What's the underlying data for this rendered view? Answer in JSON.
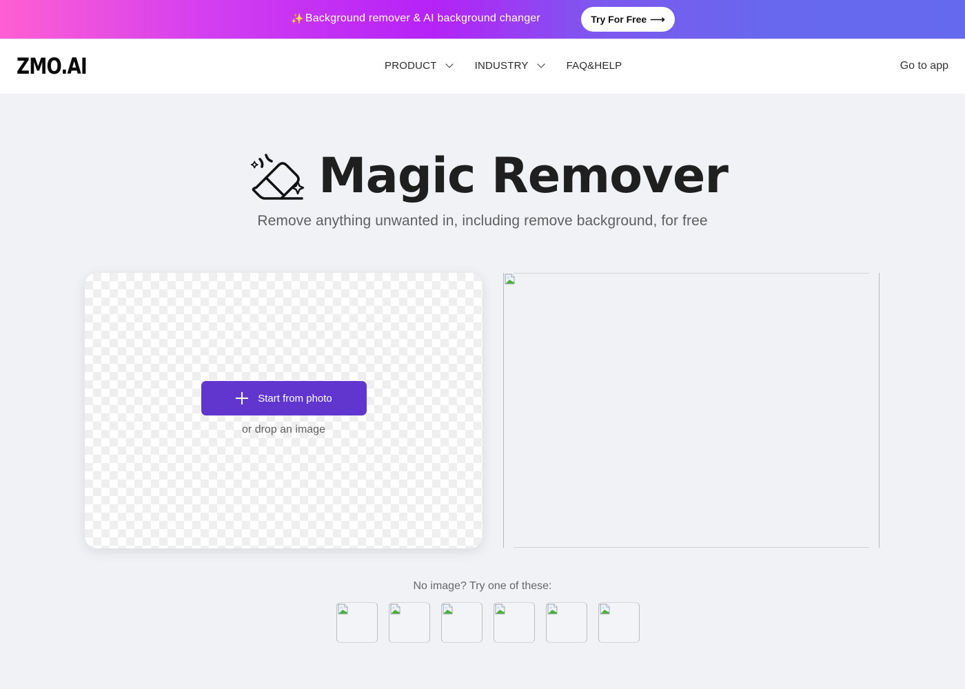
{
  "promo": {
    "sparkle_icon": "sparkles-icon",
    "text": "Background remover & AI background changer",
    "cta_label": "Try For Free",
    "cta_icon": "arrow-right-icon",
    "gradient_colors": [
      "#ff5fd2",
      "#b522f7",
      "#6569ee"
    ]
  },
  "nav": {
    "logo": "ZMO.AI",
    "items": [
      {
        "label": "PRODUCT",
        "has_dropdown": true
      },
      {
        "label": "INDUSTRY",
        "has_dropdown": true
      },
      {
        "label": "FAQ&HELP",
        "has_dropdown": false
      }
    ],
    "go_to_app": "Go to app"
  },
  "hero": {
    "icon": "magic-eraser-icon",
    "title": "Magic Remover",
    "subtitle": "Remove anything unwanted in, including remove background, for free"
  },
  "upload": {
    "button_label": "Start from photo",
    "button_icon": "plus-icon",
    "drop_hint": "or drop an image",
    "accent_color": "#6036cf"
  },
  "preview": {
    "image": "broken-image-icon"
  },
  "samples": {
    "label": "No image? Try one of these:",
    "items": [
      {
        "image": "broken-image-icon"
      },
      {
        "image": "broken-image-icon"
      },
      {
        "image": "broken-image-icon"
      },
      {
        "image": "broken-image-icon"
      },
      {
        "image": "broken-image-icon"
      },
      {
        "image": "broken-image-icon"
      }
    ]
  }
}
